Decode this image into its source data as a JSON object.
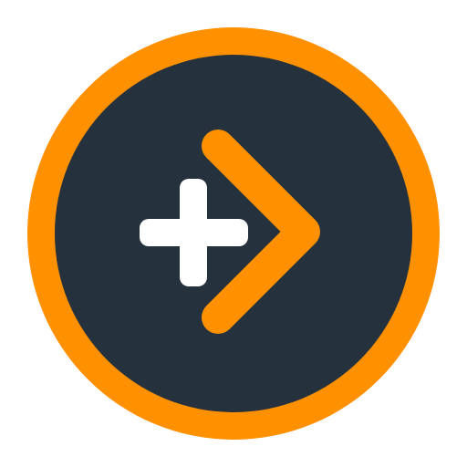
{
  "app_icon": {
    "name": "app-icon",
    "colors": {
      "background": "#FFFFFF",
      "ring": "#FF9100",
      "disc": "#25313D",
      "plus": "#FFFFFF",
      "chevron": "#FF9100"
    },
    "icons": {
      "plus": "plus-icon",
      "chevron": "chevron-right-icon"
    }
  }
}
